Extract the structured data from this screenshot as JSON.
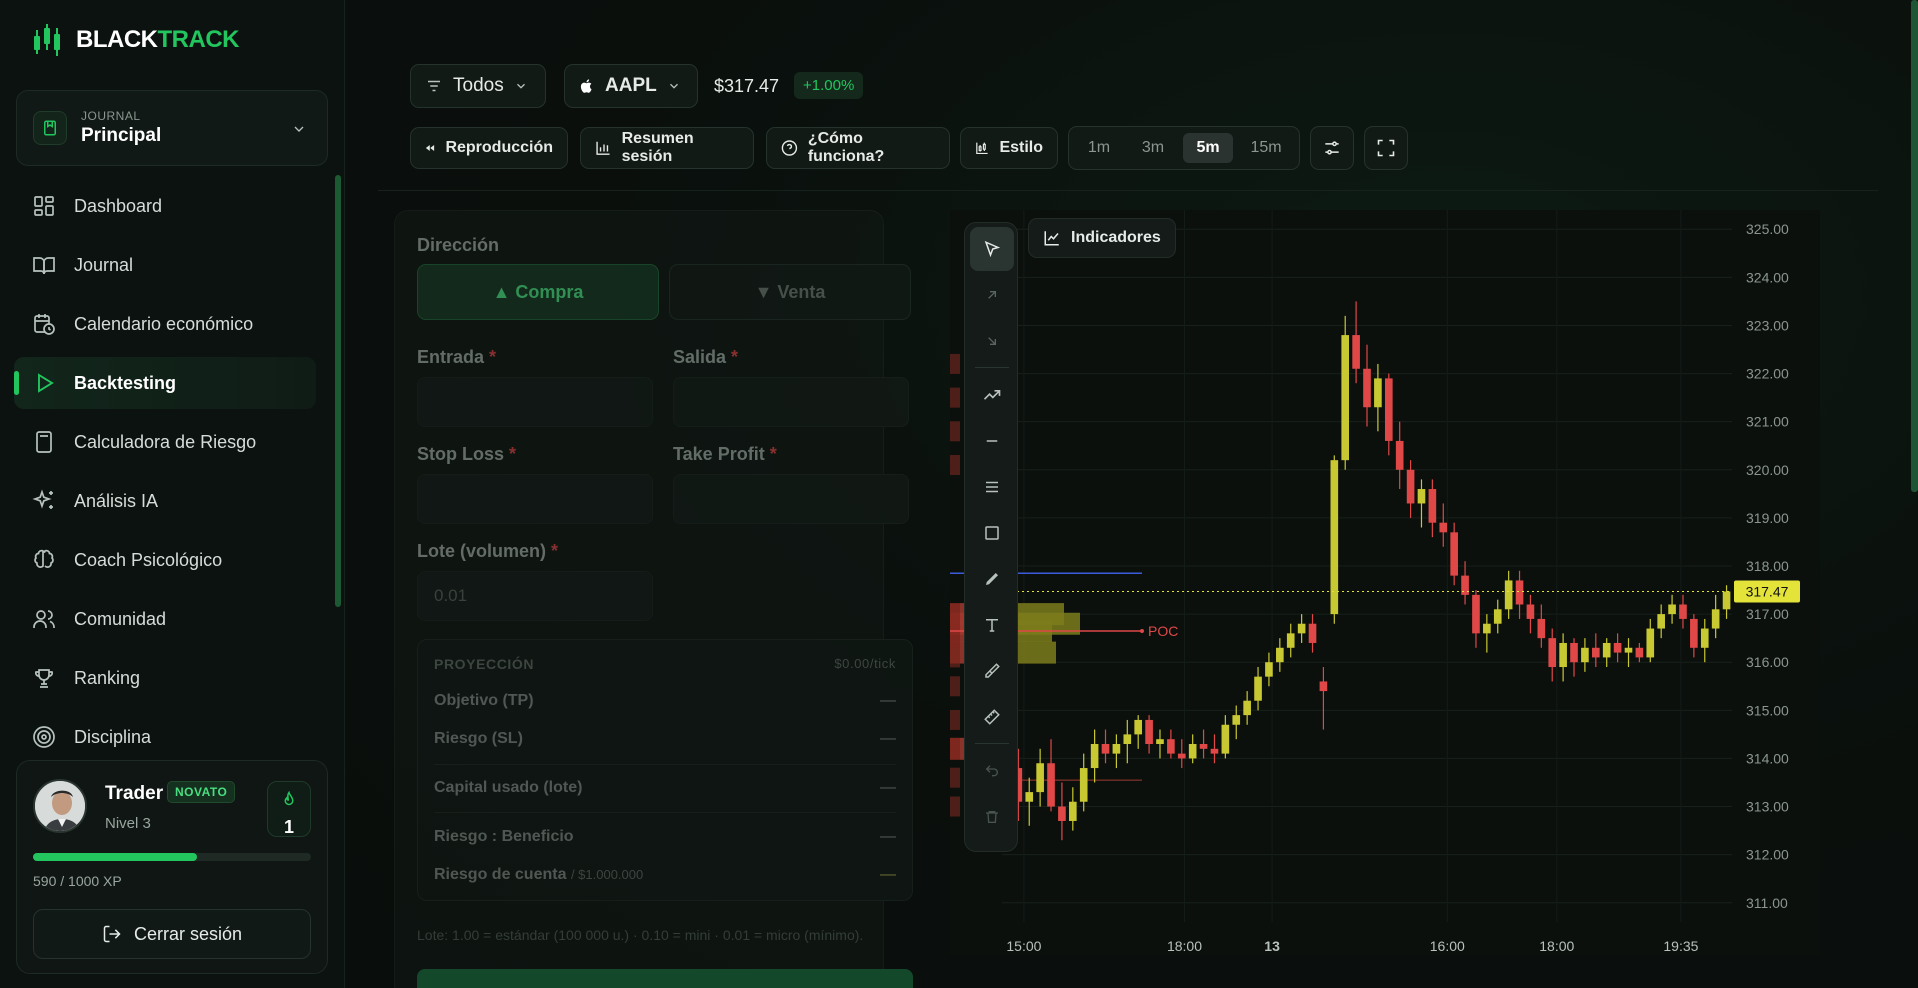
{
  "brand": {
    "name_white": "BLACK",
    "name_green": "TRACK"
  },
  "journal": {
    "small_label": "JOURNAL",
    "name": "Principal"
  },
  "nav": [
    {
      "label": "Dashboard",
      "icon": "dashboard-icon"
    },
    {
      "label": "Journal",
      "icon": "book-icon"
    },
    {
      "label": "Calendario económico",
      "icon": "calendar-clock-icon"
    },
    {
      "label": "Backtesting",
      "icon": "play-icon",
      "active": true
    },
    {
      "label": "Calculadora de Riesgo",
      "icon": "calculator-icon"
    },
    {
      "label": "Análisis IA",
      "icon": "sparkles-icon"
    },
    {
      "label": "Coach Psicológico",
      "icon": "brain-icon"
    },
    {
      "label": "Comunidad",
      "icon": "users-icon"
    },
    {
      "label": "Ranking",
      "icon": "trophy-icon"
    },
    {
      "label": "Disciplina",
      "icon": "target-icon"
    }
  ],
  "user": {
    "name": "Trader",
    "badge": "NOVATO",
    "level": "Nivel 3",
    "streak": "1",
    "xp_text": "590 / 1000 XP",
    "xp_progress": 0.59,
    "logout": "Cerrar sesión"
  },
  "toolbar": {
    "filter": "Todos",
    "symbol": "AAPL",
    "price": "$317.47",
    "change": "+1.00%",
    "replay": "Reproducción",
    "session_summary": "Resumen sesión",
    "how_it_works": "¿Cómo funciona?",
    "style": "Estilo",
    "timeframes": [
      "1m",
      "3m",
      "5m",
      "15m"
    ],
    "active_timeframe": "5m"
  },
  "order": {
    "direction_label": "Dirección",
    "buy": "▲ Compra",
    "sell": "▼ Venta",
    "entry_label": "Entrada",
    "exit_label": "Salida",
    "sl_label": "Stop Loss",
    "tp_label": "Take Profit",
    "required_mark": "*",
    "lot_label": "Lote (volumen)",
    "lot_placeholder": "0.01",
    "projection": {
      "title": "PROYECCIÓN",
      "per_tick": "$0.00/tick",
      "target": "Objetivo (TP)",
      "risk": "Riesgo (SL)",
      "capital": "Capital usado (lote)",
      "rr": "Riesgo : Beneficio",
      "account_risk": "Riesgo de cuenta",
      "account_size": "/ $1.000.000",
      "dash": "—"
    },
    "lot_note": "Lote: 1.00 = estándar (100 000 u.) · 0.10 = mini · 0.01 = micro (mínimo)."
  },
  "chart_ui": {
    "indicators": "Indicadores",
    "poc_label": "POC",
    "current_price_label": "317.47"
  },
  "chart_data": {
    "type": "candlestick",
    "symbol": "AAPL",
    "interval": "5m",
    "current_price": 317.47,
    "ylim": [
      310.6,
      325.4
    ],
    "y_ticks": [
      "325.00",
      "324.00",
      "323.00",
      "322.00",
      "321.00",
      "320.00",
      "319.00",
      "318.00",
      "317.00",
      "316.00",
      "315.00",
      "314.00",
      "313.00",
      "312.00",
      "311.00"
    ],
    "x_ticks": [
      "15:00",
      "18:00",
      "13",
      "16:00",
      "18:00",
      "19:35"
    ],
    "poc_price": 316.65,
    "colors": {
      "up": "#c8c832",
      "down": "#e04848",
      "poc": "#e04848",
      "last_price": "#e3e33a",
      "line_blue": "#3b5bdb"
    },
    "candles": [
      {
        "o": 312.9,
        "h": 314.6,
        "l": 312.3,
        "c": 313.8
      },
      {
        "o": 313.8,
        "h": 314.2,
        "l": 312.7,
        "c": 313.1
      },
      {
        "o": 313.1,
        "h": 313.6,
        "l": 312.6,
        "c": 313.3
      },
      {
        "o": 313.3,
        "h": 314.2,
        "l": 313.0,
        "c": 313.9
      },
      {
        "o": 313.9,
        "h": 314.4,
        "l": 312.9,
        "c": 313.0
      },
      {
        "o": 313.0,
        "h": 313.5,
        "l": 312.3,
        "c": 312.7
      },
      {
        "o": 312.7,
        "h": 313.4,
        "l": 312.5,
        "c": 313.1
      },
      {
        "o": 313.1,
        "h": 314.1,
        "l": 312.9,
        "c": 313.8
      },
      {
        "o": 313.8,
        "h": 314.6,
        "l": 313.5,
        "c": 314.3
      },
      {
        "o": 314.3,
        "h": 314.6,
        "l": 313.9,
        "c": 314.1
      },
      {
        "o": 314.1,
        "h": 314.5,
        "l": 313.8,
        "c": 314.3
      },
      {
        "o": 314.3,
        "h": 314.8,
        "l": 313.9,
        "c": 314.5
      },
      {
        "o": 314.5,
        "h": 314.9,
        "l": 314.2,
        "c": 314.8
      },
      {
        "o": 314.8,
        "h": 314.9,
        "l": 314.1,
        "c": 314.3
      },
      {
        "o": 314.3,
        "h": 314.6,
        "l": 314.0,
        "c": 314.4
      },
      {
        "o": 314.4,
        "h": 314.6,
        "l": 314.0,
        "c": 314.1
      },
      {
        "o": 314.1,
        "h": 314.4,
        "l": 313.8,
        "c": 314.0
      },
      {
        "o": 314.0,
        "h": 314.5,
        "l": 313.9,
        "c": 314.3
      },
      {
        "o": 314.3,
        "h": 314.6,
        "l": 314.0,
        "c": 314.2
      },
      {
        "o": 314.2,
        "h": 314.5,
        "l": 313.9,
        "c": 314.1
      },
      {
        "o": 314.1,
        "h": 314.9,
        "l": 314.0,
        "c": 314.7
      },
      {
        "o": 314.7,
        "h": 315.1,
        "l": 314.4,
        "c": 314.9
      },
      {
        "o": 314.9,
        "h": 315.4,
        "l": 314.7,
        "c": 315.2
      },
      {
        "o": 315.2,
        "h": 315.9,
        "l": 315.0,
        "c": 315.7
      },
      {
        "o": 315.7,
        "h": 316.2,
        "l": 315.5,
        "c": 316.0
      },
      {
        "o": 316.0,
        "h": 316.5,
        "l": 315.8,
        "c": 316.3
      },
      {
        "o": 316.3,
        "h": 316.8,
        "l": 316.1,
        "c": 316.6
      },
      {
        "o": 316.6,
        "h": 317.0,
        "l": 316.4,
        "c": 316.8
      },
      {
        "o": 316.8,
        "h": 317.0,
        "l": 316.2,
        "c": 316.4
      },
      {
        "o": 315.6,
        "h": 315.9,
        "l": 314.6,
        "c": 315.4
      },
      {
        "o": 317.0,
        "h": 320.3,
        "l": 316.8,
        "c": 320.2
      },
      {
        "o": 320.2,
        "h": 323.2,
        "l": 320.0,
        "c": 322.8
      },
      {
        "o": 322.8,
        "h": 323.5,
        "l": 321.8,
        "c": 322.1
      },
      {
        "o": 322.1,
        "h": 322.6,
        "l": 320.9,
        "c": 321.3
      },
      {
        "o": 321.3,
        "h": 322.2,
        "l": 320.8,
        "c": 321.9
      },
      {
        "o": 321.9,
        "h": 322.0,
        "l": 320.3,
        "c": 320.6
      },
      {
        "o": 320.6,
        "h": 321.0,
        "l": 319.6,
        "c": 320.0
      },
      {
        "o": 320.0,
        "h": 320.2,
        "l": 319.0,
        "c": 319.3
      },
      {
        "o": 319.3,
        "h": 319.8,
        "l": 318.8,
        "c": 319.6
      },
      {
        "o": 319.6,
        "h": 319.8,
        "l": 318.6,
        "c": 318.9
      },
      {
        "o": 318.9,
        "h": 319.3,
        "l": 318.4,
        "c": 318.7
      },
      {
        "o": 318.7,
        "h": 318.9,
        "l": 317.6,
        "c": 317.8
      },
      {
        "o": 317.8,
        "h": 318.1,
        "l": 317.2,
        "c": 317.4
      },
      {
        "o": 317.4,
        "h": 317.5,
        "l": 316.3,
        "c": 316.6
      },
      {
        "o": 316.6,
        "h": 317.0,
        "l": 316.2,
        "c": 316.8
      },
      {
        "o": 316.8,
        "h": 317.3,
        "l": 316.6,
        "c": 317.1
      },
      {
        "o": 317.1,
        "h": 317.9,
        "l": 316.9,
        "c": 317.7
      },
      {
        "o": 317.7,
        "h": 317.9,
        "l": 316.9,
        "c": 317.2
      },
      {
        "o": 317.2,
        "h": 317.4,
        "l": 316.6,
        "c": 316.9
      },
      {
        "o": 316.9,
        "h": 317.2,
        "l": 316.3,
        "c": 316.5
      },
      {
        "o": 316.5,
        "h": 316.7,
        "l": 315.6,
        "c": 315.9
      },
      {
        "o": 315.9,
        "h": 316.6,
        "l": 315.6,
        "c": 316.4
      },
      {
        "o": 316.4,
        "h": 316.5,
        "l": 315.7,
        "c": 316.0
      },
      {
        "o": 316.0,
        "h": 316.5,
        "l": 315.8,
        "c": 316.3
      },
      {
        "o": 316.3,
        "h": 316.6,
        "l": 315.9,
        "c": 316.1
      },
      {
        "o": 316.1,
        "h": 316.5,
        "l": 315.9,
        "c": 316.4
      },
      {
        "o": 316.4,
        "h": 316.6,
        "l": 316.0,
        "c": 316.2
      },
      {
        "o": 316.2,
        "h": 316.5,
        "l": 315.9,
        "c": 316.3
      },
      {
        "o": 316.3,
        "h": 316.4,
        "l": 316.0,
        "c": 316.1
      },
      {
        "o": 316.1,
        "h": 316.9,
        "l": 316.0,
        "c": 316.7
      },
      {
        "o": 316.7,
        "h": 317.2,
        "l": 316.5,
        "c": 317.0
      },
      {
        "o": 317.0,
        "h": 317.4,
        "l": 316.8,
        "c": 317.2
      },
      {
        "o": 317.2,
        "h": 317.4,
        "l": 316.7,
        "c": 316.9
      },
      {
        "o": 316.9,
        "h": 317.0,
        "l": 316.1,
        "c": 316.3
      },
      {
        "o": 316.3,
        "h": 316.9,
        "l": 316.0,
        "c": 316.7
      },
      {
        "o": 316.7,
        "h": 317.4,
        "l": 316.5,
        "c": 317.1
      },
      {
        "o": 317.1,
        "h": 317.6,
        "l": 316.9,
        "c": 317.47
      }
    ],
    "volume_profile": [
      {
        "price": 317.0,
        "buy": 0.4,
        "sell": 0.12
      },
      {
        "price": 316.8,
        "buy": 0.46,
        "sell": 0.14
      },
      {
        "price": 316.65,
        "buy": 0.36,
        "sell": 0.1
      },
      {
        "price": 316.2,
        "buy": 0.3,
        "sell": 0.18
      },
      {
        "price": 314.2,
        "buy": 0.1,
        "sell": 0.06
      }
    ]
  }
}
